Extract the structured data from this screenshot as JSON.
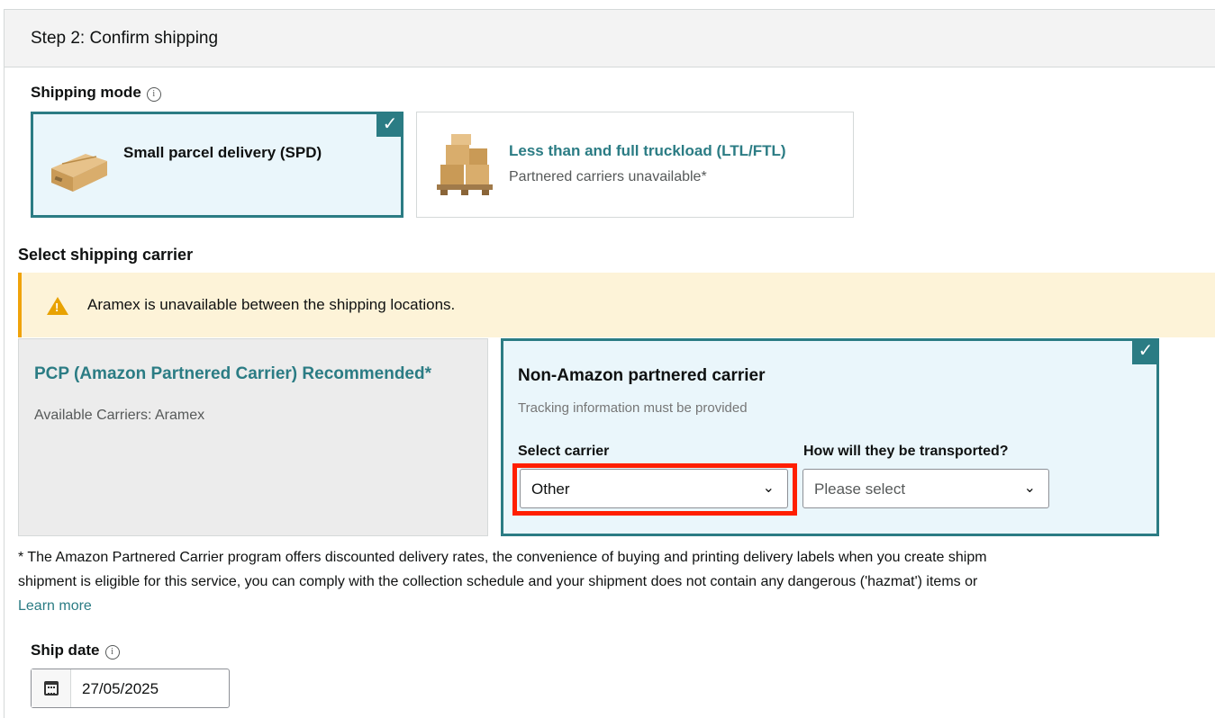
{
  "step": {
    "title": "Step 2: Confirm shipping"
  },
  "shipping_mode": {
    "label": "Shipping mode",
    "options": [
      {
        "title": "Small parcel delivery (SPD)",
        "subtitle": "",
        "selected": true,
        "icon": "parcel-box-icon"
      },
      {
        "title": "Less than and full truckload (LTL/FTL)",
        "subtitle": "Partnered carriers unavailable*",
        "selected": false,
        "icon": "pallet-boxes-icon"
      }
    ]
  },
  "carrier_section": {
    "label": "Select shipping carrier",
    "warning": "Aramex is unavailable between the shipping locations.",
    "pcp": {
      "title": "PCP (Amazon Partnered Carrier) Recommended*",
      "subtitle": "Available Carriers: Aramex"
    },
    "non_amazon": {
      "title": "Non-Amazon partnered carrier",
      "subtitle": "Tracking information must be provided",
      "carrier_label": "Select carrier",
      "carrier_value": "Other",
      "transport_label": "How will they be transported?",
      "transport_value": "Please select",
      "selected": true
    }
  },
  "footnote": {
    "line1": "* The Amazon Partnered Carrier program offers discounted delivery rates, the convenience of buying and printing delivery labels when you create shipm",
    "line2": "shipment is eligible for this service, you can comply with the collection schedule and your shipment does not contain any dangerous ('hazmat') items or",
    "link": "Learn more"
  },
  "ship_date": {
    "label": "Ship date",
    "value": "27/05/2025"
  },
  "colors": {
    "accent": "#2b7c84",
    "warning_bg": "#fdf3d8",
    "warning_bar": "#f0a30a",
    "highlight": "#ff1f00"
  }
}
